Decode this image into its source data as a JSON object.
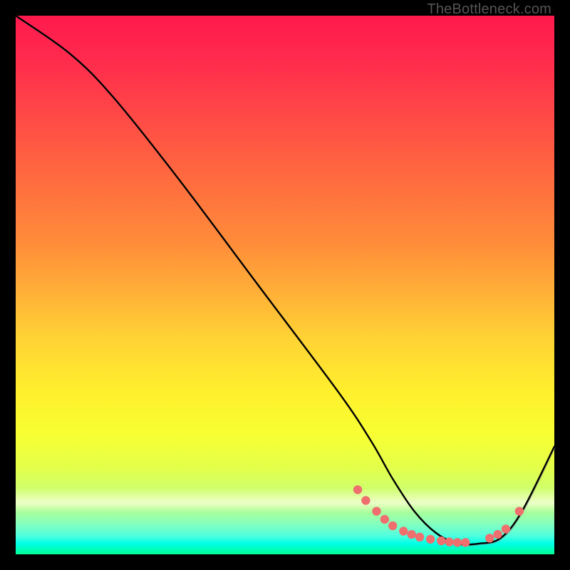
{
  "attribution": "TheBottleneck.com",
  "colors": {
    "page_bg": "#000000",
    "curve": "#000000",
    "curve_shadow": "#888888",
    "marker_fill": "#ef6e6e",
    "marker_stroke": "#d24a4a"
  },
  "chart_data": {
    "type": "line",
    "title": "",
    "xlabel": "",
    "ylabel": "",
    "xlim": [
      0,
      100
    ],
    "ylim": [
      0,
      100
    ],
    "grid": false,
    "legend": false,
    "series": [
      {
        "name": "curve",
        "x": [
          0,
          10,
          18,
          30,
          45,
          60,
          66,
          70,
          74,
          78,
          82,
          86,
          90,
          94,
          100
        ],
        "y": [
          100,
          93,
          85,
          70,
          50,
          30,
          21,
          14,
          8,
          4,
          2,
          2,
          3,
          8,
          20
        ]
      }
    ],
    "markers": {
      "x": [
        63.5,
        65.0,
        67.0,
        68.5,
        70.0,
        72.0,
        73.5,
        75.0,
        77.0,
        79.0,
        80.5,
        82.0,
        83.5,
        88.0,
        89.5,
        91.0,
        93.5
      ],
      "y": [
        12.0,
        10.0,
        8.0,
        6.5,
        5.3,
        4.3,
        3.7,
        3.2,
        2.8,
        2.5,
        2.3,
        2.2,
        2.2,
        3.0,
        3.7,
        4.7,
        8.0
      ]
    }
  }
}
